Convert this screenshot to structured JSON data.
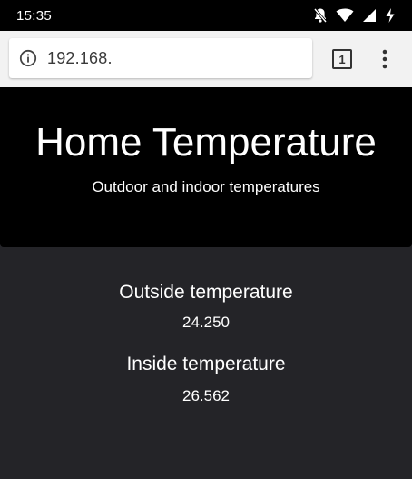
{
  "status_bar": {
    "time": "15:35",
    "icons": [
      "notifications-off-icon",
      "wifi-icon",
      "signal-icon",
      "battery-charging-icon"
    ]
  },
  "browser": {
    "url": "192.168.",
    "tab_count": "1",
    "icons": [
      "info-icon",
      "tab-switcher-icon",
      "more-vert-icon"
    ]
  },
  "hero": {
    "title": "Home Temperature",
    "subtitle": "Outdoor and indoor temperatures"
  },
  "readings": {
    "outside_label": "Outside temperature",
    "outside_value": "24.250",
    "inside_label": "Inside temperature",
    "inside_value": "26.562"
  },
  "colors": {
    "status_bar_bg": "#000000",
    "browser_bar_bg": "#f2f2f2",
    "hero_bg": "#000000",
    "page_bg": "#242428",
    "text": "#ffffff"
  }
}
